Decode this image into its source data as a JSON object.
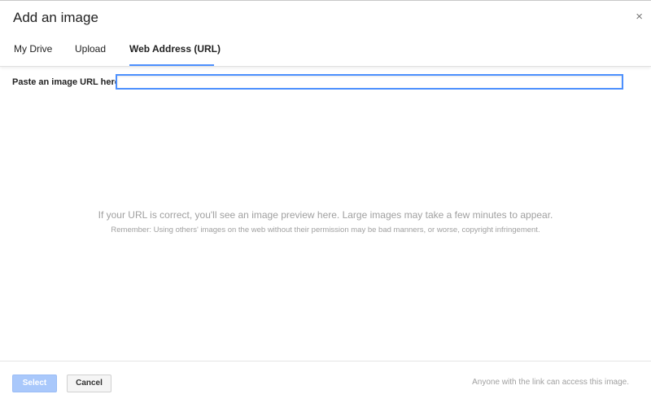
{
  "dialog": {
    "title": "Add an image",
    "close_glyph": "×"
  },
  "tabs": [
    {
      "label": "My Drive",
      "active": false
    },
    {
      "label": "Upload",
      "active": false
    },
    {
      "label": "Web Address (URL)",
      "active": true
    }
  ],
  "url_field": {
    "label": "Paste an image URL here:",
    "value": "",
    "placeholder": ""
  },
  "preview": {
    "message": "If your URL is correct, you'll see an image preview here. Large images may take a few minutes to appear.",
    "note": "Remember: Using others' images on the web without their permission may be bad manners, or worse, copyright infringement."
  },
  "footer": {
    "select_label": "Select",
    "cancel_label": "Cancel",
    "note": "Anyone with the link can access this image."
  },
  "colors": {
    "accent": "#4d90fe",
    "select_disabled": "#a9c8fb",
    "muted_text": "#a0a0a0"
  },
  "icons": {
    "close": "close-icon"
  }
}
